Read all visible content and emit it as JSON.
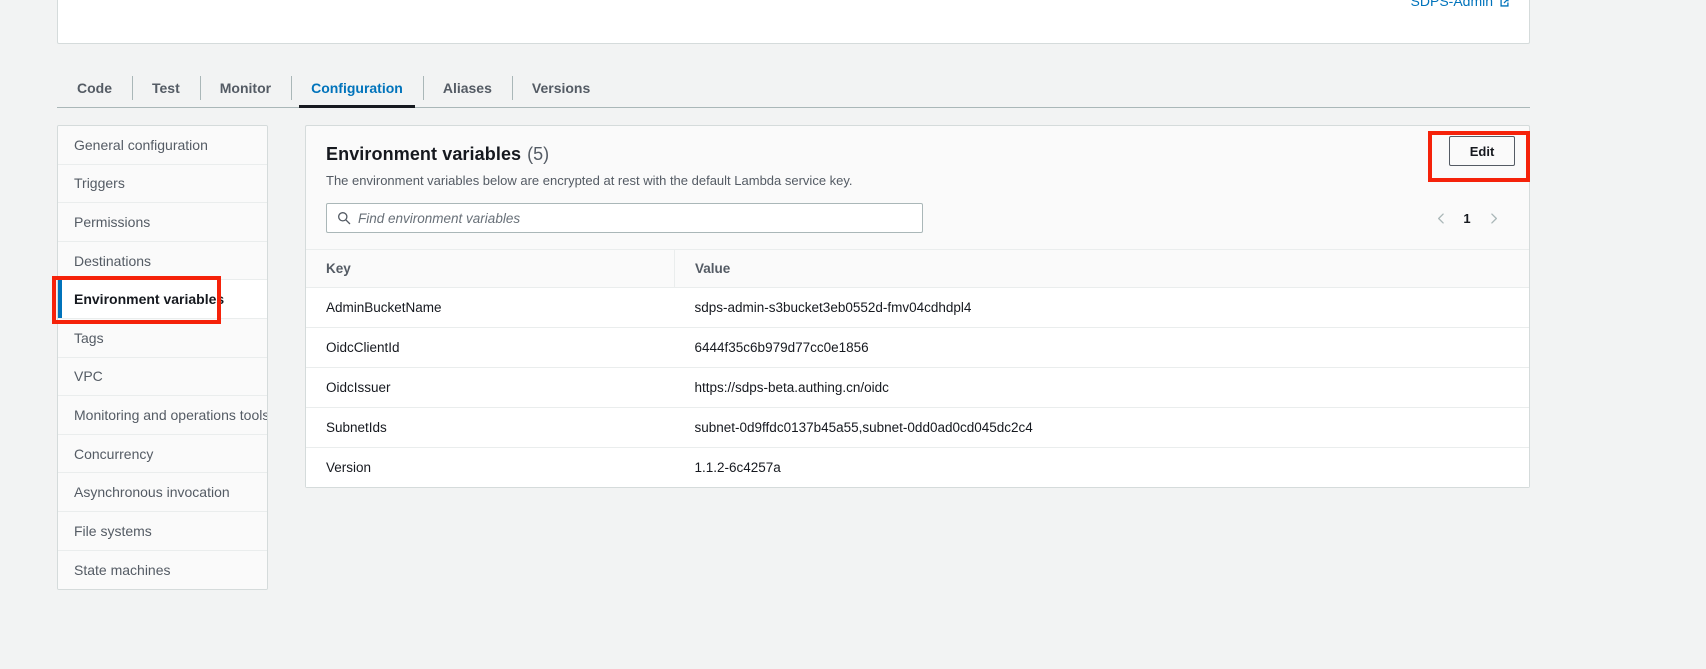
{
  "header": {
    "external_link_label": "SDPS-Admin",
    "external_link_icon": "external-link-icon"
  },
  "tabs": [
    {
      "label": "Code",
      "active": false
    },
    {
      "label": "Test",
      "active": false
    },
    {
      "label": "Monitor",
      "active": false
    },
    {
      "label": "Configuration",
      "active": true
    },
    {
      "label": "Aliases",
      "active": false
    },
    {
      "label": "Versions",
      "active": false
    }
  ],
  "sidebar": {
    "items": [
      {
        "label": "General configuration",
        "selected": false
      },
      {
        "label": "Triggers",
        "selected": false
      },
      {
        "label": "Permissions",
        "selected": false
      },
      {
        "label": "Destinations",
        "selected": false
      },
      {
        "label": "Environment variables",
        "selected": true
      },
      {
        "label": "Tags",
        "selected": false
      },
      {
        "label": "VPC",
        "selected": false
      },
      {
        "label": "Monitoring and operations tools",
        "selected": false
      },
      {
        "label": "Concurrency",
        "selected": false
      },
      {
        "label": "Asynchronous invocation",
        "selected": false
      },
      {
        "label": "File systems",
        "selected": false
      },
      {
        "label": "State machines",
        "selected": false
      }
    ]
  },
  "panel": {
    "title": "Environment variables",
    "count": "(5)",
    "description": "The environment variables below are encrypted at rest with the default Lambda service key.",
    "edit_button": "Edit",
    "search": {
      "placeholder": "Find environment variables",
      "value": "",
      "icon": "search-icon"
    },
    "pagination": {
      "prev_icon": "chevron-left-icon",
      "page": "1",
      "next_icon": "chevron-right-icon"
    },
    "table": {
      "columns": [
        "Key",
        "Value"
      ],
      "rows": [
        {
          "key": "AdminBucketName",
          "value": "sdps-admin-s3bucket3eb0552d-fmv04cdhdpl4"
        },
        {
          "key": "OidcClientId",
          "value": "6444f35c6b979d77cc0e1856"
        },
        {
          "key": "OidcIssuer",
          "value": "https://sdps-beta.authing.cn/oidc"
        },
        {
          "key": "SubnetIds",
          "value": "subnet-0d9ffdc0137b45a55,subnet-0dd0ad0cd045dc2c4"
        },
        {
          "key": "Version",
          "value": "1.1.2-6c4257a"
        }
      ]
    }
  },
  "annotations": {
    "color": "#f5220a",
    "boxes": [
      {
        "target": "sidebar-item-environment-variables"
      },
      {
        "target": "edit-button"
      }
    ]
  }
}
